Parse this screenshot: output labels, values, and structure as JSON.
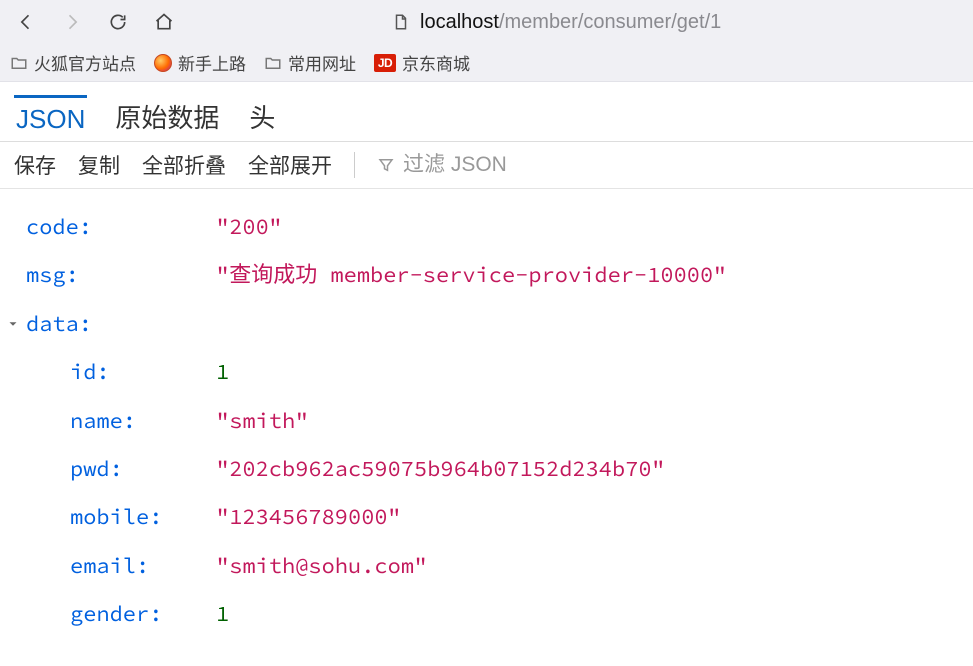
{
  "nav": {
    "url_host": "localhost",
    "url_path": "/member/consumer/get/1"
  },
  "bookmarks": {
    "firefox_official": "火狐官方站点",
    "getting_started": "新手上路",
    "common_sites": "常用网址",
    "jd_mall": "京东商城",
    "jd_badge": "JD"
  },
  "view_tabs": {
    "json": "JSON",
    "raw": "原始数据",
    "headers": "头"
  },
  "actions": {
    "save": "保存",
    "copy": "复制",
    "collapse_all": "全部折叠",
    "expand_all": "全部展开",
    "filter_placeholder": "过滤 JSON"
  },
  "json": {
    "code_key": "code:",
    "code_val": "\"200\"",
    "msg_key": "msg:",
    "msg_val": "\"查询成功 member-service-provider-10000\"",
    "data_key": "data:",
    "id_key": "id:",
    "id_val": "1",
    "name_key": "name:",
    "name_val": "\"smith\"",
    "pwd_key": "pwd:",
    "pwd_val": "\"202cb962ac59075b964b07152d234b70\"",
    "mobile_key": "mobile:",
    "mobile_val": "\"123456789000\"",
    "email_key": "email:",
    "email_val": "\"smith@sohu.com\"",
    "gender_key": "gender:",
    "gender_val": "1"
  }
}
